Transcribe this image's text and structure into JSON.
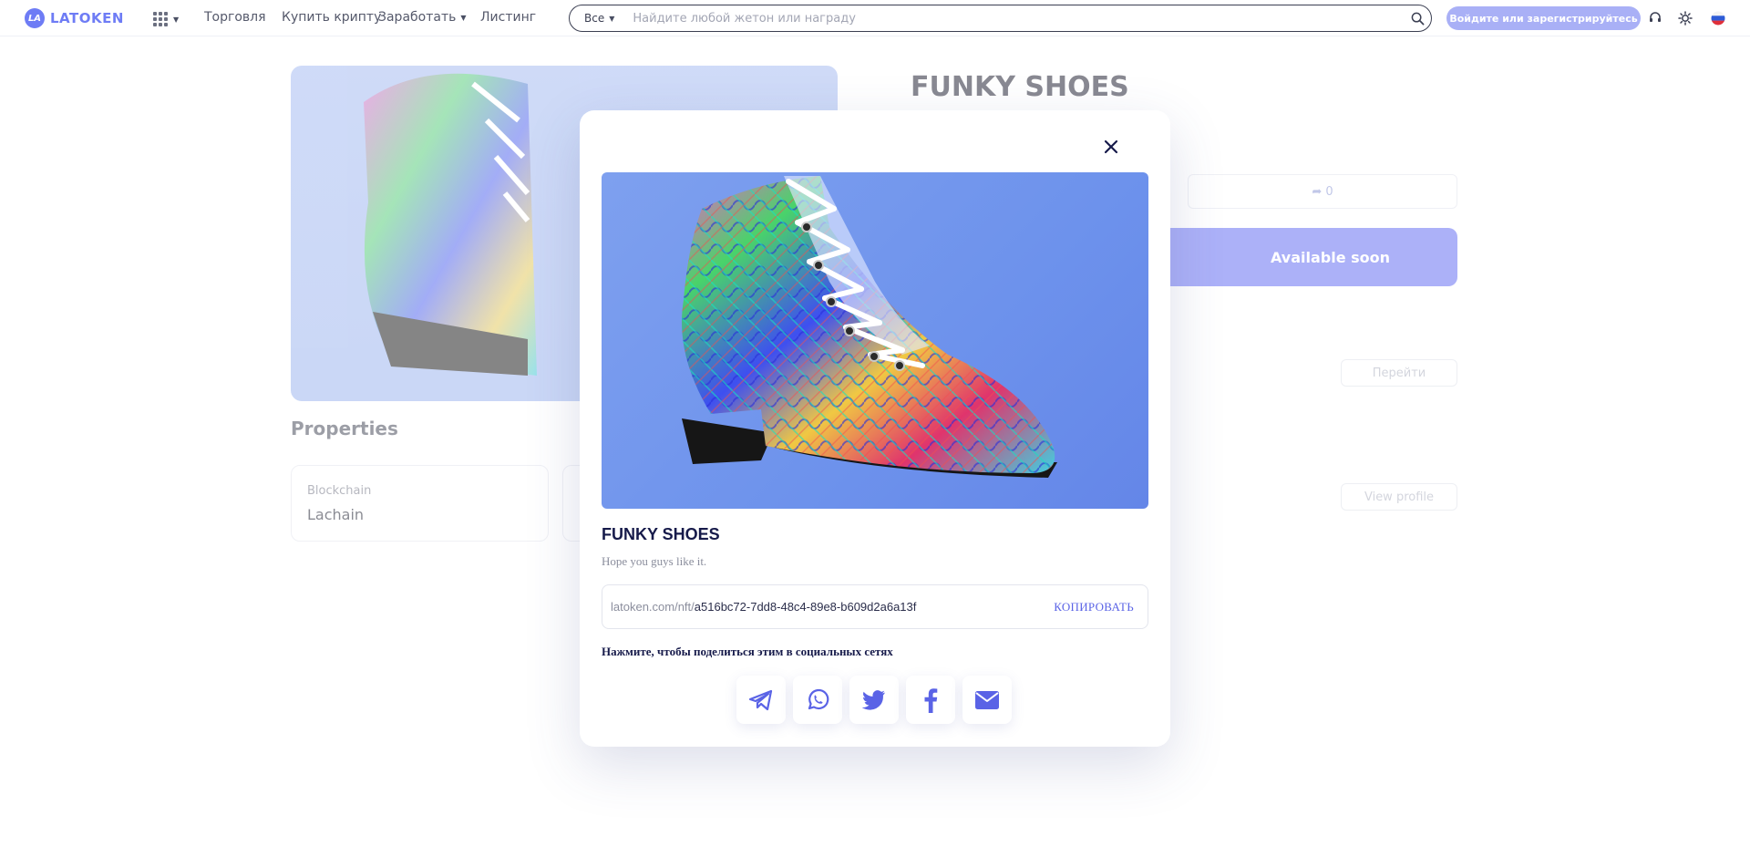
{
  "header": {
    "logo_text": "LATOKEN",
    "logo_mark": "LA",
    "apps_icon": "apps-grid-icon",
    "nav": [
      {
        "label": "Торговля"
      },
      {
        "label": "Купить крипту"
      },
      {
        "label": "Заработать"
      },
      {
        "label": "Листинг"
      }
    ],
    "search": {
      "category": "Все",
      "placeholder": "Найдите любой жетон или награду",
      "value": ""
    },
    "login_label": "Войдите или зарегистрируйтесь",
    "icons": [
      "support-icon",
      "theme-icon",
      "language-flag-icon"
    ]
  },
  "background": {
    "title": "FUNKY SHOES",
    "share_count": "0",
    "available_label": "Available soon",
    "goto_label": "Перейти",
    "view_profile_label": "View profile",
    "properties_heading": "Properties",
    "property_cards": [
      {
        "label": "Blockchain",
        "value": "Lachain"
      }
    ]
  },
  "modal": {
    "title": "FUNKY SHOES",
    "description": "Hope you guys like it.",
    "link_prefix": "latoken.com/nft/",
    "link_id": "a516bc72-7dd8-48c4-89e8-b609d2a6a13f",
    "copy_label": "КОПИРОВАТЬ",
    "share_label": "Нажмите, чтобы поделиться этим в социальных сетях",
    "share_icons": [
      "telegram-icon",
      "whatsapp-icon",
      "twitter-icon",
      "facebook-icon",
      "email-icon"
    ]
  },
  "colors": {
    "brand": "#6e7cf5",
    "accent": "#5a63e6",
    "login_button": "#a9b0f6",
    "available_button": "#6a73f3",
    "image_background": "#7ea0ef"
  }
}
